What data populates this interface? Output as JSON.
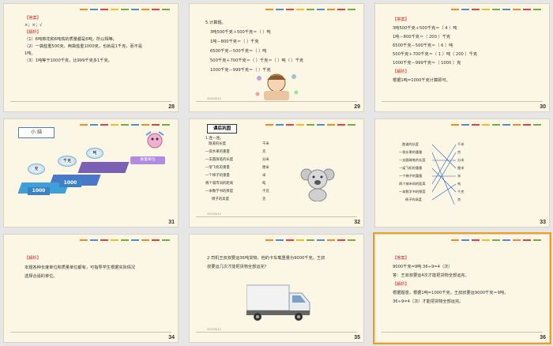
{
  "slides": [
    {
      "number": "28",
      "lines": [
        "【答案】",
        "×；×；√",
        "【解析】",
        "（1）6吨棉花和6吨铁的质量都是6吨，所以相等。",
        "（2）一袋盐重500克，两袋盐重1000克，也就是1千克，而不是",
        "1吨。",
        "（3）1吨等于1000千克，比999千克多1千克。"
      ]
    },
    {
      "number": "29",
      "lines": [
        "5.计算题。",
        "3吨500千克＋500千克＝（        ）吨",
        "1吨－800千克＝（        ）千克",
        "6500千克－500千克＝（        ）吨",
        "500千克＋700千克＝（        ）千克＝（        ）吨（        ）千克",
        "1000千克－999千克＝（        ）千克"
      ],
      "date": "2022/9/12"
    },
    {
      "number": "30",
      "lines": [
        "【答案】",
        "3吨500千克＋500千克＝（   4   ）吨",
        "1吨－800千克＝（  200  ）千克",
        "6500千克－500千克＝（   6   ）吨",
        "500千克＋700千克＝（   1   ）吨（   200   ）千克",
        "1000千克－999千克＝（   1000   ）克",
        "【解析】",
        "根据1吨=1000千克计算即可。"
      ]
    },
    {
      "number": "31",
      "title": "小  结",
      "labels": [
        "吨",
        "千克",
        "克",
        "1000",
        "1000"
      ],
      "button": "质量单位"
    },
    {
      "number": "32",
      "header": "课后巩固",
      "intro": "1.连一连。",
      "left": [
        "跑道的长度",
        "一袋水果的重量",
        "一支圆珠笔的长度",
        "一架飞机的重量",
        "一个梯子的重量",
        "两个城市间的距离",
        "一本数学书的厚度",
        "椅子的高度"
      ],
      "right": [
        "千米",
        "克",
        "分米",
        "厘米",
        "米",
        "吨",
        "千克",
        "克"
      ],
      "date": "2022/9/12"
    },
    {
      "number": "33",
      "left": [
        "跑道的长度",
        "一袋水果的重量",
        "一支圆珠笔的长度",
        "一架飞机的重量",
        "一个梯子的重量",
        "两个城市间的距离",
        "一本数学书的厚度",
        "椅子的高度"
      ],
      "right": [
        "千米",
        "克",
        "分米",
        "厘米",
        "米",
        "吨",
        "千克",
        "克"
      ]
    },
    {
      "number": "34",
      "lines": [
        "【解析】",
        "本题各种长度单位和质量单位都有，可指导学生根据实际情况",
        "选择合适的单位。"
      ]
    },
    {
      "number": "35",
      "lines": [
        "2.司机王叔叔要运36吨货物，他的卡车载重量为9000千克。王叔",
        "叔要运几次才能把货物全部运完？"
      ],
      "date": "2022/9/12"
    },
    {
      "number": "36",
      "lines": [
        "【答案】",
        "9000千克=9吨        36÷9=4（次）",
        "答：王叔叔要运4次才能把货物全部运完。",
        "【解析】",
        "根据题意，根据1吨=1000千克，王叔叔要运9000千克＝9吨，",
        "36÷9=4（次）才能把货物全部运完。"
      ]
    }
  ],
  "colors": {
    "slide_bg": "#fbf7e4",
    "accent_red": "#d02020",
    "accent_blue": "#3b82c4",
    "selected": "#f0a020"
  }
}
